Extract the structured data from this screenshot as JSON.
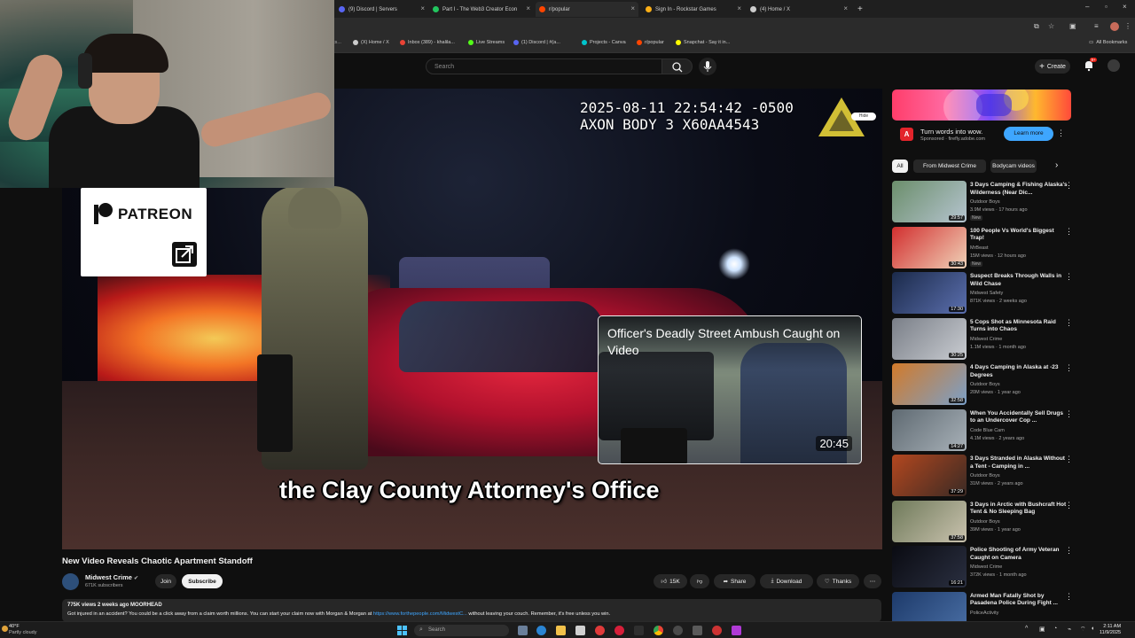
{
  "browser": {
    "tabs": [
      {
        "title": "(9) Discord | Servers",
        "color": "#5865f2"
      },
      {
        "title": "Part I - The Web3 Creator Econ",
        "color": "#22c55e"
      },
      {
        "title": "r/popular",
        "color": "#ff4500"
      },
      {
        "title": "Sign In - Rockstar Games",
        "color": "#fcaf17"
      },
      {
        "title": "(4) Home / X",
        "color": "#cccccc"
      }
    ],
    "new_tab": "+",
    "bookmarks": [
      {
        "label": "(X) Home / X",
        "color": "#cccccc"
      },
      {
        "label": "Inbox (389) - khalila...",
        "color": "#ea4335"
      },
      {
        "label": "Live Streams",
        "color": "#53fc18"
      },
      {
        "label": "(1) Discord | #(a...",
        "color": "#5865f2"
      },
      {
        "label": "Projects - Canva",
        "color": "#00c4cc"
      },
      {
        "label": "r/popular",
        "color": "#ff4500"
      },
      {
        "label": "Snapchat - Say it in...",
        "color": "#fffc00"
      }
    ],
    "all_bookmarks": "All Bookmarks"
  },
  "patreon": {
    "label": "PATREON"
  },
  "youtube": {
    "search_placeholder": "Search",
    "create_label": "Create",
    "notif_count": "9+"
  },
  "player": {
    "timestamp": "2025-08-11 22:54:42 -0500\nAXON BODY 3 X60AA4543",
    "hide_label": "Hide",
    "caption": "the Clay County Attorney's Office",
    "endcard": {
      "title": "Officer's Deadly Street Ambush Caught on Video",
      "duration": "20:45"
    }
  },
  "video": {
    "title": "New Video Reveals Chaotic Apartment Standoff",
    "channel": "Midwest Crime",
    "subscribers": "671K subscribers",
    "join": "Join",
    "subscribe": "Subscribe",
    "likes": "15K",
    "share": "Share",
    "download": "Download",
    "thanks": "Thanks",
    "meta": "775K views  2 weeks ago  MOORHEAD",
    "desc_before": "Got injured in an accident? You could be a click away from a claim worth millions. You can start your claim now with Morgan & Morgan at ",
    "desc_link": "https://www.forthepeople.com/MidwestC...",
    "desc_after": "  without leaving your couch. Remember, it's free unless you win."
  },
  "ad": {
    "title": "Turn words into wow.",
    "sponsored": "Sponsored · firefly.adobe.com",
    "learn_more": "Learn more",
    "logo_letter": "A"
  },
  "chips": [
    "All",
    "From Midwest Crime",
    "Bodycam videos"
  ],
  "recommendations": [
    {
      "title": "3 Days Camping & Fishing Alaska's Wilderness (Near Dic...",
      "channel": "Outdoor Boys",
      "meta": "3.9M views · 17 hours ago",
      "duration": "29:57",
      "badge": "New",
      "c1": "#6b8e6b",
      "c2": "#b5c4cf"
    },
    {
      "title": "100 People Vs World's Biggest Trap!",
      "channel": "MrBeast",
      "meta": "15M views · 12 hours ago",
      "duration": "30:43",
      "badge": "New",
      "c1": "#d22f2f",
      "c2": "#f0d2b8"
    },
    {
      "title": "Suspect Breaks Through Walls in Wild Chase",
      "channel": "Midwest Safety",
      "meta": "871K views · 2 weeks ago",
      "duration": "17:30",
      "badge": "",
      "c1": "#1b2a4a",
      "c2": "#5b6fae"
    },
    {
      "title": "5 Cops Shot as Minnesota Raid Turns into Chaos",
      "channel": "Midwest Crime",
      "meta": "1.1M views · 1 month ago",
      "duration": "30:25",
      "badge": "",
      "c1": "#7a7f88",
      "c2": "#c9ccd1"
    },
    {
      "title": "4 Days Camping in Alaska at -23 Degrees",
      "channel": "Outdoor Boys",
      "meta": "20M views · 1 year ago",
      "duration": "32:58",
      "badge": "",
      "c1": "#d27a2a",
      "c2": "#7ba0c8"
    },
    {
      "title": "When You Accidentally Sell Drugs to an Undercover Cop ...",
      "channel": "Code Blue Cam",
      "meta": "4.1M views · 2 years ago",
      "duration": "14:27",
      "badge": "",
      "c1": "#5f6a72",
      "c2": "#a8b1b8"
    },
    {
      "title": "3 Days Stranded in Alaska Without a Tent - Camping in ...",
      "channel": "Outdoor Boys",
      "meta": "31M views · 2 years ago",
      "duration": "37:29",
      "badge": "",
      "c1": "#b3471f",
      "c2": "#3a2a24"
    },
    {
      "title": "3 Days in Arctic with Bushcraft Hot Tent & No Sleeping Bag",
      "channel": "Outdoor Boys",
      "meta": "39M views · 1 year ago",
      "duration": "37:58",
      "badge": "",
      "c1": "#6f7a5a",
      "c2": "#c9c2ae"
    },
    {
      "title": "Police Shooting of Army Veteran Caught on Camera",
      "channel": "Midwest Crime",
      "meta": "372K views · 1 month ago",
      "duration": "16:21",
      "badge": "",
      "c1": "#0a0b12",
      "c2": "#2a2f40"
    },
    {
      "title": "Armed Man Fatally Shot by Pasadena Police During Fight ...",
      "channel": "PoliceActivity",
      "meta": "",
      "duration": "",
      "badge": "",
      "c1": "#1d3a6a",
      "c2": "#4a6fa5"
    }
  ],
  "taskbar": {
    "weather_temp": "40°F",
    "weather_desc": "Partly cloudy",
    "search": "Search",
    "time": "2:11 AM",
    "date": "11/9/2025"
  }
}
